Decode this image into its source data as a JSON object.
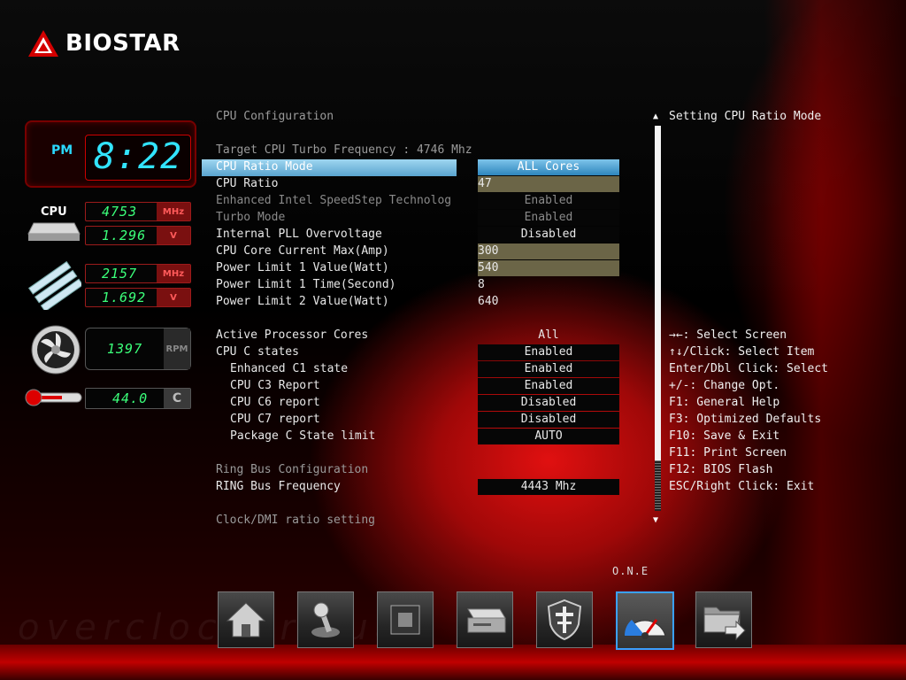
{
  "brand": {
    "name": "BIOSTAR"
  },
  "status": {
    "clock_period": "PM",
    "clock_time": "8:22",
    "cpu_label": "CPU",
    "cpu_freq": "4753",
    "cpu_freq_unit": "MHz",
    "cpu_volt": "1.296",
    "cpu_volt_unit": "V",
    "mem_freq": "2157",
    "mem_freq_unit": "MHz",
    "mem_volt": "1.692",
    "mem_volt_unit": "V",
    "fan_rpm": "1397",
    "fan_unit": "RPM",
    "temp": "44.0",
    "temp_unit": "C"
  },
  "menu": {
    "page_title": "CPU Configuration",
    "turbo_info": "Target CPU Turbo Frequency : 4746 Mhz",
    "rows": [
      {
        "label": "CPU Ratio Mode",
        "value": "ALL Cores"
      },
      {
        "label": "CPU Ratio",
        "value": "47"
      },
      {
        "label": "Enhanced Intel SpeedStep Technolog",
        "value": "Enabled"
      },
      {
        "label": "Turbo Mode",
        "value": "Enabled"
      },
      {
        "label": "Internal PLL Overvoltage",
        "value": "Disabled"
      },
      {
        "label": "CPU Core Current Max(Amp)",
        "value": "300"
      },
      {
        "label": "Power Limit 1 Value(Watt)",
        "value": "540"
      },
      {
        "label": "Power Limit 1 Time(Second)",
        "value": "8"
      },
      {
        "label": "Power Limit 2 Value(Watt)",
        "value": "640"
      }
    ],
    "rows2": [
      {
        "label": "Active Processor Cores",
        "value": "All"
      },
      {
        "label": "CPU C states",
        "value": "Enabled"
      },
      {
        "label": "Enhanced C1 state",
        "value": "Enabled"
      },
      {
        "label": "CPU C3 Report",
        "value": "Enabled"
      },
      {
        "label": "CPU C6 report",
        "value": "Disabled"
      },
      {
        "label": "CPU C7 report",
        "value": "Disabled"
      },
      {
        "label": "Package C State limit",
        "value": "AUTO"
      }
    ],
    "ring_section": "Ring Bus Configuration",
    "ring_row": {
      "label": "RING Bus Frequency",
      "value": "4443 Mhz"
    },
    "clock_section": "Clock/DMI ratio setting"
  },
  "help": {
    "title": "Setting CPU Ratio Mode",
    "keys": [
      "→←: Select Screen",
      "↑↓/Click: Select Item",
      "Enter/Dbl Click: Select",
      "+/-: Change Opt.",
      "F1: General Help",
      "F3: Optimized Defaults",
      "F10: Save & Exit",
      "F11: Print Screen",
      "F12: BIOS Flash",
      "ESC/Right Click: Exit"
    ]
  },
  "dock": {
    "active_label": "O.N.E",
    "items": [
      "home-icon",
      "joystick-icon",
      "chip-icon",
      "drive-icon",
      "shield-cross-icon",
      "speedometer-icon",
      "folder-exit-icon"
    ]
  },
  "colors": {
    "accent_blue": "#5aa4cf",
    "lcd_green": "#3bff7a",
    "clock_cyan": "#32e4ff",
    "brand_red": "#d00000"
  }
}
